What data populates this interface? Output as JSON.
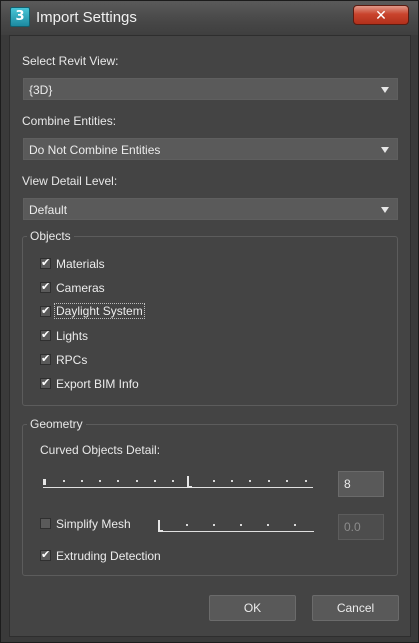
{
  "window": {
    "title": "Import Settings",
    "close_glyph": "✕"
  },
  "revit_view": {
    "label": "Select Revit View:",
    "value": "{3D}"
  },
  "combine": {
    "label": "Combine Entities:",
    "value": "Do Not Combine Entities"
  },
  "detail": {
    "label": "View Detail Level:",
    "value": "Default"
  },
  "objects": {
    "title": "Objects",
    "items": [
      {
        "label": "Materials",
        "checked": true
      },
      {
        "label": "Cameras",
        "checked": true
      },
      {
        "label": "Daylight System",
        "checked": true
      },
      {
        "label": "Lights",
        "checked": true
      },
      {
        "label": "RPCs",
        "checked": true
      },
      {
        "label": "Export BIM Info",
        "checked": true
      }
    ]
  },
  "geometry": {
    "title": "Geometry",
    "curved_label": "Curved Objects Detail:",
    "curved_value": "8",
    "simplify_label": "Simplify Mesh",
    "simplify_checked": false,
    "simplify_value": "0.0",
    "extruding_label": "Extruding Detection",
    "extruding_checked": true
  },
  "buttons": {
    "ok": "OK",
    "cancel": "Cancel"
  }
}
